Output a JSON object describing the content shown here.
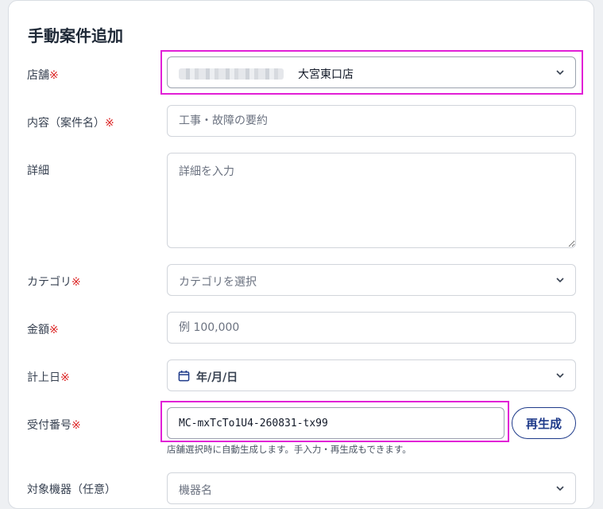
{
  "form": {
    "title": "手動案件追加",
    "required_mark": "※",
    "store": {
      "label": "店舗",
      "value": "大宮東口店"
    },
    "content": {
      "label": "内容（案件名）",
      "placeholder": "工事・故障の要約"
    },
    "detail": {
      "label": "詳細",
      "placeholder": "詳細を入力"
    },
    "category": {
      "label": "カテゴリ",
      "placeholder": "カテゴリを選択"
    },
    "amount": {
      "label": "金額",
      "placeholder": "例 100,000"
    },
    "date": {
      "label": "計上日",
      "value": "年/月/日"
    },
    "receipt": {
      "label": "受付番号",
      "value": "MC-mxTcTo1U4-260831-tx99",
      "regen_label": "再生成",
      "help": "店舗選択時に自動生成します。手入力・再生成もできます。"
    },
    "equipment": {
      "label": "対象機器（任意）",
      "placeholder": "機器名"
    }
  },
  "colors": {
    "accent": "#1e3a8a",
    "required": "#dc2626",
    "highlight": "#e11fd6"
  }
}
